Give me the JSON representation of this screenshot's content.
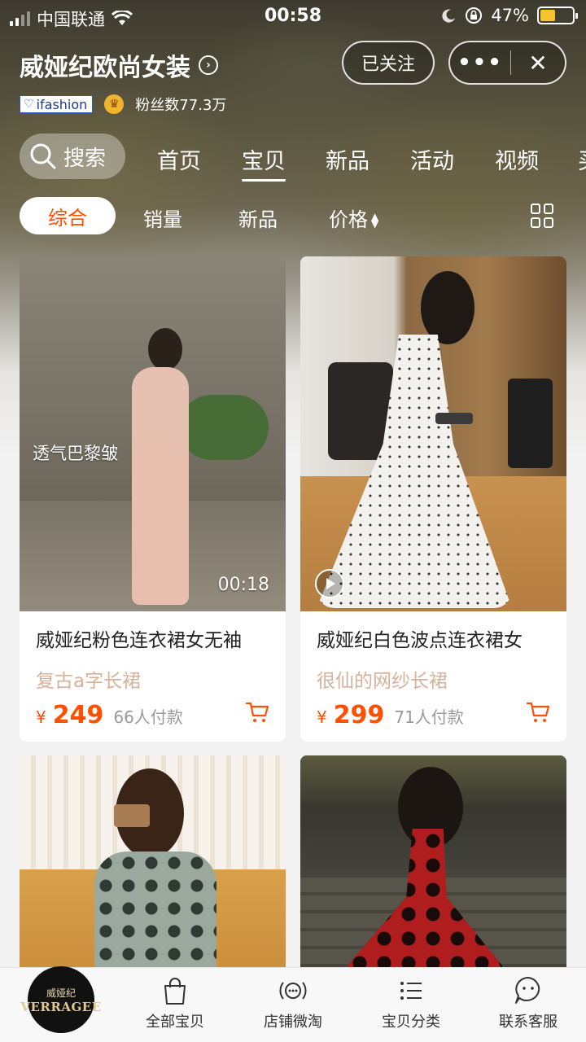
{
  "status_bar": {
    "carrier": "中国联通",
    "time": "00:58",
    "battery_percent": "47%",
    "battery_level": 0.47,
    "battery_color": "#f5c42c"
  },
  "store": {
    "name": "威娅纪欧尚女装",
    "badge": "ifashion",
    "followers": "粉丝数77.3万",
    "follow_button": "已关注",
    "more_button": "•••",
    "close_button": "✕"
  },
  "nav": {
    "search_label": "搜索",
    "tabs": [
      "首页",
      "宝贝",
      "新品",
      "活动",
      "视频",
      "买"
    ],
    "active_tab": "宝贝"
  },
  "filters": {
    "items": [
      "综合",
      "销量",
      "新品",
      "价格"
    ],
    "active": "综合",
    "accent_color": "#ff5000"
  },
  "products": [
    {
      "title": "威娅纪粉色连衣裙女无袖",
      "subtitle": "复古a字长裙",
      "currency": "¥",
      "price": "249",
      "sold": "66人付款",
      "overlay_text": "透气巴黎皱",
      "video_duration": "00:18"
    },
    {
      "title": "威娅纪白色波点连衣裙女",
      "subtitle": "很仙的网纱长裙",
      "currency": "¥",
      "price": "299",
      "sold": "71人付款"
    },
    {
      "title": "",
      "subtitle": ""
    },
    {
      "title": "",
      "subtitle": ""
    }
  ],
  "tab_bar": {
    "logo_line1": "威娅纪",
    "logo_line2": "VERRAGEE",
    "items": [
      {
        "label": "全部宝贝",
        "icon": "shopping-bag-icon"
      },
      {
        "label": "店铺微淘",
        "icon": "broadcast-icon"
      },
      {
        "label": "宝贝分类",
        "icon": "list-icon"
      },
      {
        "label": "联系客服",
        "icon": "chat-face-icon"
      }
    ]
  }
}
